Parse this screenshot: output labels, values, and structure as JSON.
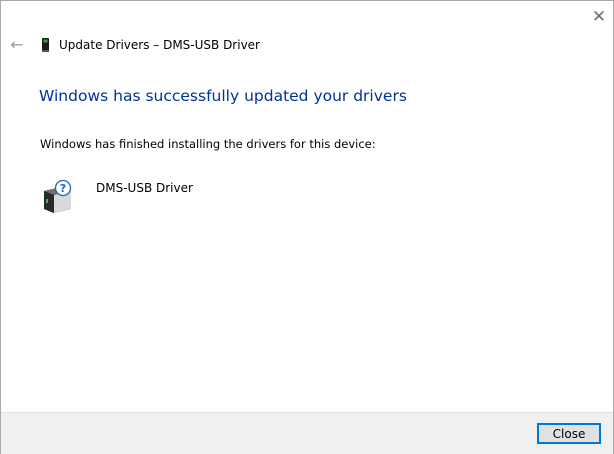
{
  "window": {
    "title": "Update Drivers – DMS-USB Driver",
    "close_glyph": "✕",
    "back_glyph": "←"
  },
  "main": {
    "heading": "Windows has successfully updated your drivers",
    "subtext": "Windows has finished installing the drivers for this device:",
    "device": {
      "name": "DMS-USB Driver",
      "icon": "unknown-device-icon"
    }
  },
  "footer": {
    "close_label": "Close"
  },
  "colors": {
    "heading": "#003399",
    "button_border": "#0078d7",
    "footer_bg": "#f0f0f0"
  }
}
